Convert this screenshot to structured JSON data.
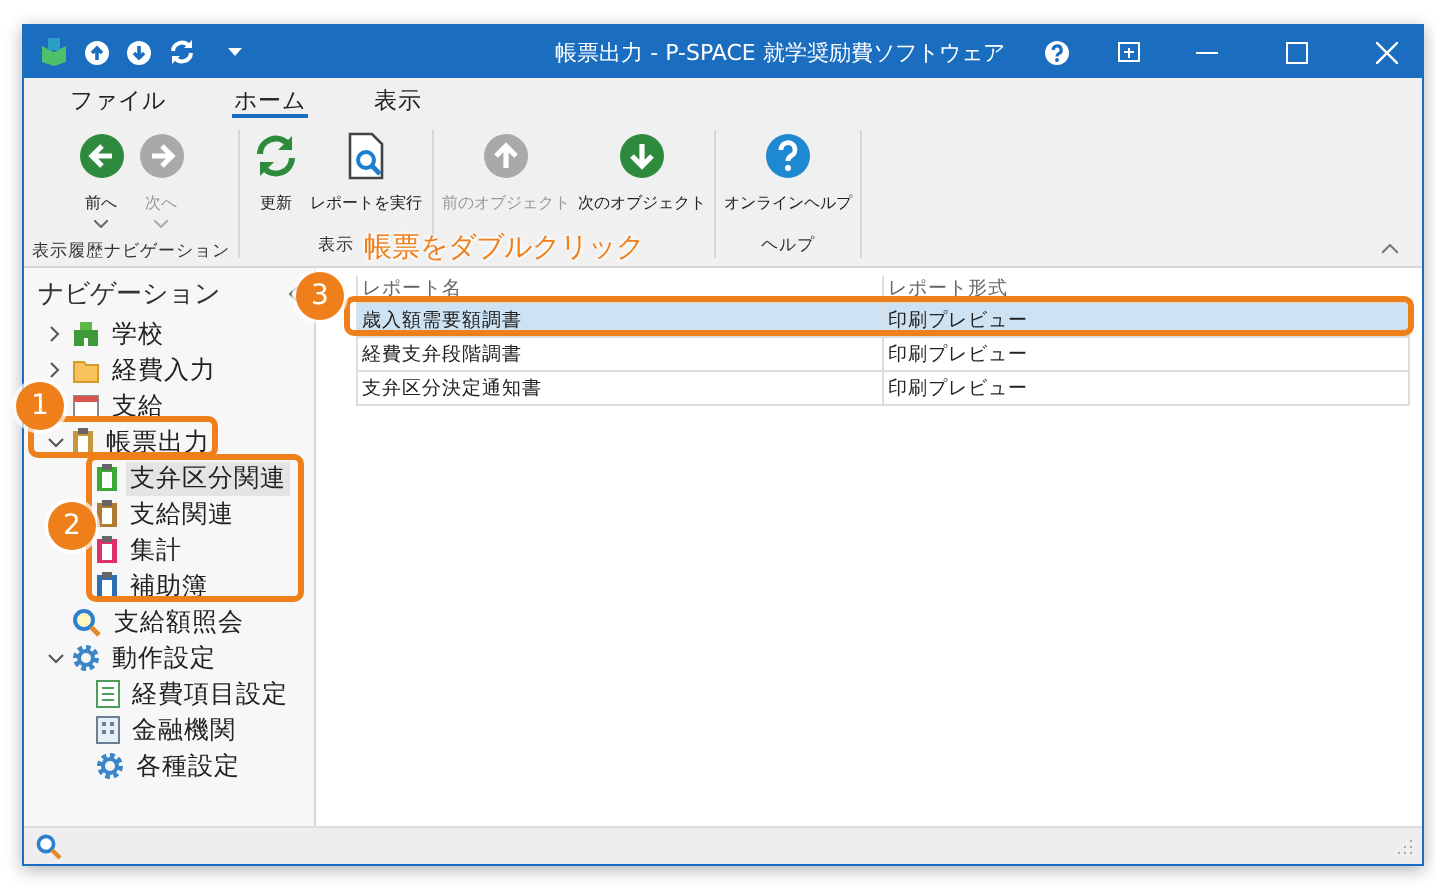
{
  "window": {
    "title": "帳票出力 - P-SPACE 就学奨励費ソフトウェア"
  },
  "menu_tabs": [
    {
      "label": "ファイル",
      "selected": false
    },
    {
      "label": "ホーム",
      "selected": true
    },
    {
      "label": "表示",
      "selected": false
    }
  ],
  "ribbon_groups": [
    {
      "label": "表示履歴ナビゲーション",
      "buttons": [
        {
          "label": "前へ",
          "disabled": false,
          "dropdown": true
        },
        {
          "label": "次へ",
          "disabled": true,
          "dropdown": true
        }
      ]
    },
    {
      "label": "表示",
      "buttons": [
        {
          "label": "更新",
          "disabled": false,
          "dropdown": false
        },
        {
          "label": "レポートを実行",
          "disabled": false,
          "dropdown": false
        }
      ]
    },
    {
      "buttons": [
        {
          "label": "前のオブジェクト",
          "disabled": true,
          "dropdown": false
        },
        {
          "label": "次のオブジェクト",
          "disabled": false,
          "dropdown": false
        }
      ]
    },
    {
      "label": "ヘルプ",
      "buttons": [
        {
          "label": "オンラインヘルプ",
          "disabled": false,
          "dropdown": false
        }
      ]
    }
  ],
  "navigation": {
    "title": "ナビゲーション",
    "items": [
      {
        "label": "学校",
        "expanded": false,
        "selected": false
      },
      {
        "label": "経費入力",
        "expanded": false,
        "selected": false
      },
      {
        "label": "支給",
        "expanded": false,
        "selected": false
      },
      {
        "label": "帳票出力",
        "color": "#c8963c",
        "expanded": true,
        "selected": false,
        "children": [
          {
            "label": "支弁区分関連",
            "color": "#3aaa35",
            "selected": true
          },
          {
            "label": "支給関連",
            "color": "#b07a30",
            "selected": false
          },
          {
            "label": "集計",
            "color": "#e0306a",
            "selected": false
          },
          {
            "label": "補助簿",
            "color": "#2f6db5",
            "selected": false
          }
        ]
      },
      {
        "label": "支給額照会",
        "selected": false
      },
      {
        "label": "動作設定",
        "expanded": true,
        "selected": false,
        "children": [
          {
            "label": "経費項目設定",
            "selected": false
          },
          {
            "label": "金融機関",
            "selected": false
          },
          {
            "label": "各種設定",
            "selected": false
          }
        ]
      }
    ]
  },
  "table": {
    "columns": [
      "レポート名",
      "レポート形式"
    ],
    "rows": [
      {
        "cells": [
          "歳入額需要額調書",
          "印刷プレビュー"
        ],
        "selected": true
      },
      {
        "cells": [
          "経費支弁段階調書",
          "印刷プレビュー"
        ],
        "selected": false
      },
      {
        "cells": [
          "支弁区分決定通知書",
          "印刷プレビュー"
        ],
        "selected": false
      }
    ]
  },
  "callouts": [
    {
      "number": "1"
    },
    {
      "number": "2"
    },
    {
      "number": "3",
      "text": "帳票をダブルクリック"
    }
  ]
}
